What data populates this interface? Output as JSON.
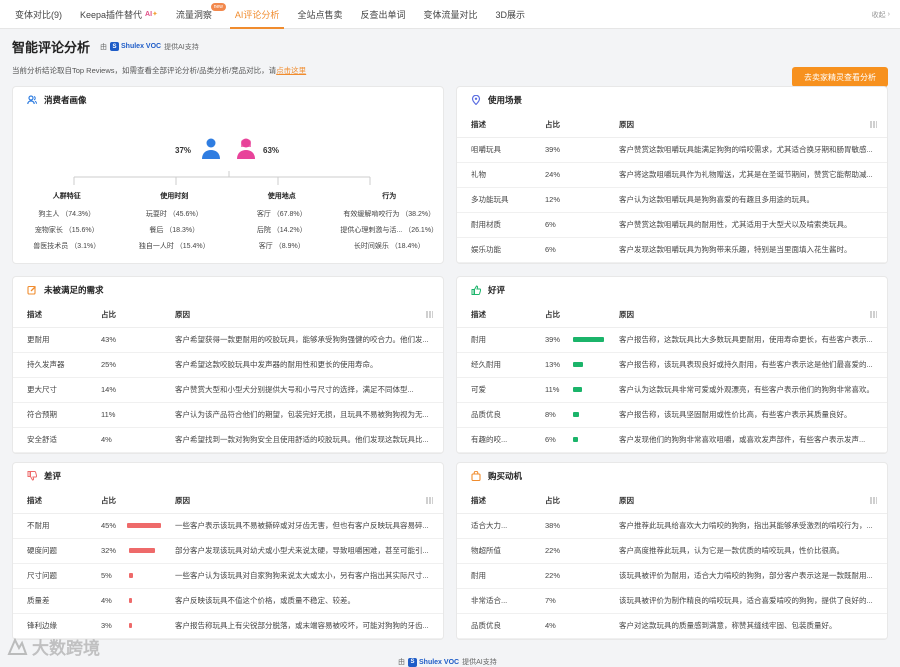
{
  "tabs": [
    {
      "label": "变体对比(9)"
    },
    {
      "label": "Keepa插件替代",
      "sup": "AI"
    },
    {
      "label": "流量洞察",
      "badge": "new"
    },
    {
      "label": "AI评论分析",
      "active": true
    },
    {
      "label": "全站点售卖"
    },
    {
      "label": "反查出单词"
    },
    {
      "label": "变体流量对比"
    },
    {
      "label": "3D展示"
    }
  ],
  "collapse_label": "收起",
  "header": {
    "title": "智能评论分析",
    "by_prefix": "由",
    "voc_brand": "Shulex VOC",
    "by_suffix": "提供AI支持",
    "subtitle": "当前分析结论取自Top Reviews，如需查看全部评论分析/品类分析/竞品对比，请",
    "subtitle_link": "点击这里",
    "expert_button": "去卖家精灵查看分析"
  },
  "persona": {
    "title": "消费者画像",
    "male_pct": "37%",
    "female_pct": "63%",
    "groups": [
      {
        "title": "人群特征",
        "items": [
          "狗主人 （74.3%）",
          "宠物家长 （15.6%）",
          "兽医技术员 （3.1%）"
        ]
      },
      {
        "title": "使用时刻",
        "items": [
          "玩耍时 （45.6%）",
          "餐后 （18.3%）",
          "独自一人时 （15.4%）"
        ]
      },
      {
        "title": "使用地点",
        "items": [
          "客厅 （67.8%）",
          "后院 （14.2%）",
          "客厅 （8.9%）"
        ]
      },
      {
        "title": "行为",
        "items": [
          "有效缓解啃咬行为 （38.2%）",
          "提供心理刺激与活... （26.1%）",
          "长时间娱乐 （18.4%）"
        ]
      }
    ]
  },
  "scenario": {
    "title": "使用场景",
    "headers": [
      "描述",
      "占比",
      "原因"
    ],
    "rows": [
      {
        "desc": "咀嚼玩具",
        "pct": "39%",
        "reason": "客户赞赏这款咀嚼玩具能满足狗狗的啃咬需求，尤其适合换牙期和肠胃敏感..."
      },
      {
        "desc": "礼物",
        "pct": "24%",
        "reason": "客户将这款咀嚼玩具作为礼物赠送，尤其是在圣诞节期间，赞赏它能帮助减..."
      },
      {
        "desc": "多功能玩具",
        "pct": "12%",
        "reason": "客户认为这款咀嚼玩具是狗狗喜爱的有趣且多用途的玩具。"
      },
      {
        "desc": "耐用材质",
        "pct": "6%",
        "reason": "客户赞赏这款咀嚼玩具的耐用性，尤其适用于大型犬以及啃索类玩具。"
      },
      {
        "desc": "娱乐功能",
        "pct": "6%",
        "reason": "客户发现这款咀嚼玩具为狗狗带来乐趣，特别是当里面填入花生酱时。"
      }
    ]
  },
  "unmet": {
    "title": "未被满足的需求",
    "headers": [
      "描述",
      "占比",
      "原因"
    ],
    "rows": [
      {
        "desc": "更耐用",
        "pct": "43%",
        "reason": "客户希望获得一款更耐用的咬胶玩具，能够承受狗狗强健的咬合力。他们发..."
      },
      {
        "desc": "持久发声器",
        "pct": "25%",
        "reason": "客户希望这款咬胶玩具中发声器的耐用性和更长的使用寿命。"
      },
      {
        "desc": "更大尺寸",
        "pct": "14%",
        "reason": "客户赞赏大型和小型犬分别提供大号和小号尺寸的选择，满足不同体型..."
      },
      {
        "desc": "符合预期",
        "pct": "11%",
        "reason": "客户认为该产品符合他们的期望，包装完好无损，且玩具不易被狗狗视为无..."
      },
      {
        "desc": "安全舒适",
        "pct": "4%",
        "reason": "客户希望找到一款对狗狗安全且使用舒适的咬胶玩具。他们发现这款玩具比..."
      }
    ]
  },
  "positive": {
    "title": "好评",
    "headers": [
      "描述",
      "占比",
      "原因"
    ],
    "bar_color": "#1bb46a",
    "rows": [
      {
        "desc": "耐用",
        "pct": "39%",
        "value": 39,
        "reason": "客户报告称，这款玩具比大多数玩具更耐用，使用寿命更长，有些客户表示..."
      },
      {
        "desc": "经久耐用",
        "pct": "13%",
        "value": 13,
        "reason": "客户报告称，该玩具表现良好或持久耐用，有些客户表示这是他们最喜爱的..."
      },
      {
        "desc": "可爱",
        "pct": "11%",
        "value": 11,
        "reason": "客户认为这款玩具非常可爱或外观漂亮，有些客户表示他们的狗狗非常喜欢。"
      },
      {
        "desc": "品质优良",
        "pct": "8%",
        "value": 8,
        "reason": "客户报告称，该玩具坚固耐用或性价比高，有些客户表示其质量良好。"
      },
      {
        "desc": "有趣的咬...",
        "pct": "6%",
        "value": 6,
        "reason": "客户发现他们的狗狗非常喜欢咀嚼，或喜欢发声部件，有些客户表示发声..."
      }
    ]
  },
  "negative": {
    "title": "差评",
    "headers": [
      "描述",
      "占比",
      "原因"
    ],
    "bar_color": "#ee6a6a",
    "rows": [
      {
        "desc": "不耐用",
        "pct": "45%",
        "value": 45,
        "reason": "一些客户表示该玩具不易被撕碎或对牙齿无害，但也有客户反映玩具容易碎..."
      },
      {
        "desc": "硬度问题",
        "pct": "32%",
        "value": 32,
        "reason": "部分客户发现该玩具对幼犬或小型犬来说太硬，导致咀嚼困难，甚至可能引..."
      },
      {
        "desc": "尺寸问题",
        "pct": "5%",
        "value": 5,
        "reason": "一些客户认为该玩具对自家狗狗来说太大或太小，另有客户指出其实际尺寸..."
      },
      {
        "desc": "质量差",
        "pct": "4%",
        "value": 4,
        "reason": "客户反映该玩具不值这个价格，或质量不稳定、较差。"
      },
      {
        "desc": "锋利边缘",
        "pct": "3%",
        "value": 3,
        "reason": "客户报告称玩具上有尖锐部分脱落，或末端容易被咬坏，可能对狗狗的牙齿..."
      }
    ]
  },
  "motivation": {
    "title": "购买动机",
    "headers": [
      "描述",
      "占比",
      "原因"
    ],
    "rows": [
      {
        "desc": "适合大力...",
        "pct": "38%",
        "reason": "客户推荐此玩具给喜欢大力啃咬的狗狗，指出其能够承受激烈的啃咬行为，..."
      },
      {
        "desc": "物超所值",
        "pct": "22%",
        "reason": "客户高度推荐此玩具，认为它是一款优质的啃咬玩具，性价比很高。"
      },
      {
        "desc": "耐用",
        "pct": "22%",
        "reason": "该玩具被评价为耐用，适合大力啃咬的狗狗，部分客户表示这是一款既耐用..."
      },
      {
        "desc": "非常适合...",
        "pct": "7%",
        "reason": "该玩具被评价为制作精良的啃咬玩具，适合喜爱啃咬的狗狗，提供了良好的..."
      },
      {
        "desc": "品质优良",
        "pct": "4%",
        "reason": "客户对这款玩具的质量感到满意，称赞其缝线牢固、包装质量好。"
      }
    ]
  },
  "footer": {
    "by_prefix": "由",
    "voc_brand": "Shulex VOC",
    "by_suffix": "提供AI支持"
  },
  "watermark": "大数跨境"
}
